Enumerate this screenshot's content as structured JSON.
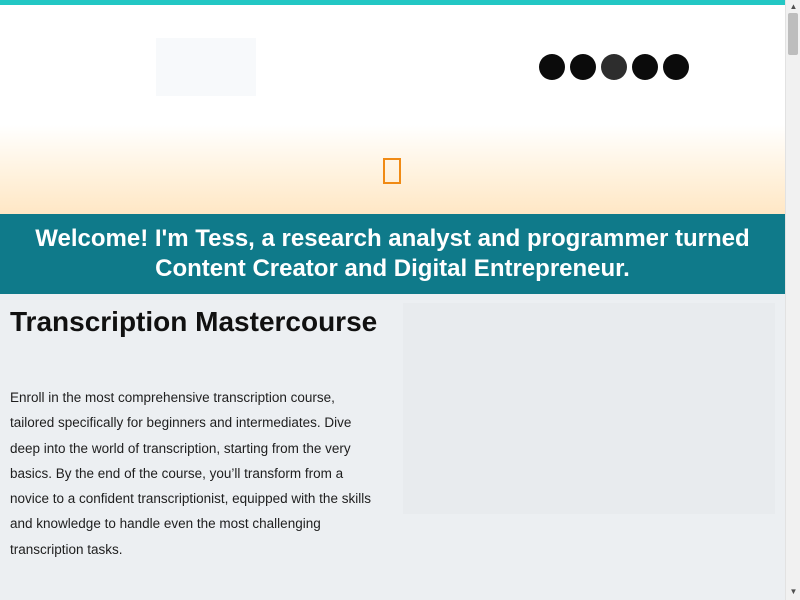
{
  "header": {
    "social_icons": [
      "social-icon-1",
      "social-icon-2",
      "social-icon-3",
      "social-icon-4",
      "social-icon-5"
    ]
  },
  "colors": {
    "accent_bar": "#22c7c4",
    "welcome_bg": "#0f7a8a",
    "menu_toggle": "#f08a14",
    "social_bg": "#0b0b0b"
  },
  "welcome": {
    "text": "Welcome! I'm Tess, a research analyst and programmer turned Content Creator and Digital Entrepreneur."
  },
  "course": {
    "title": "Transcription Mastercourse",
    "description": "Enroll in the most comprehensive transcription course, tailored specifically for beginners and intermediates. Dive deep into the world of transcription, starting from the very basics. By the end of the course, you’ll transform from a novice to a confident transcriptionist, equipped with the skills and knowledge to handle even the most challenging transcription tasks."
  },
  "scrollbar": {
    "up_icon": "▲",
    "down_icon": "▼"
  }
}
